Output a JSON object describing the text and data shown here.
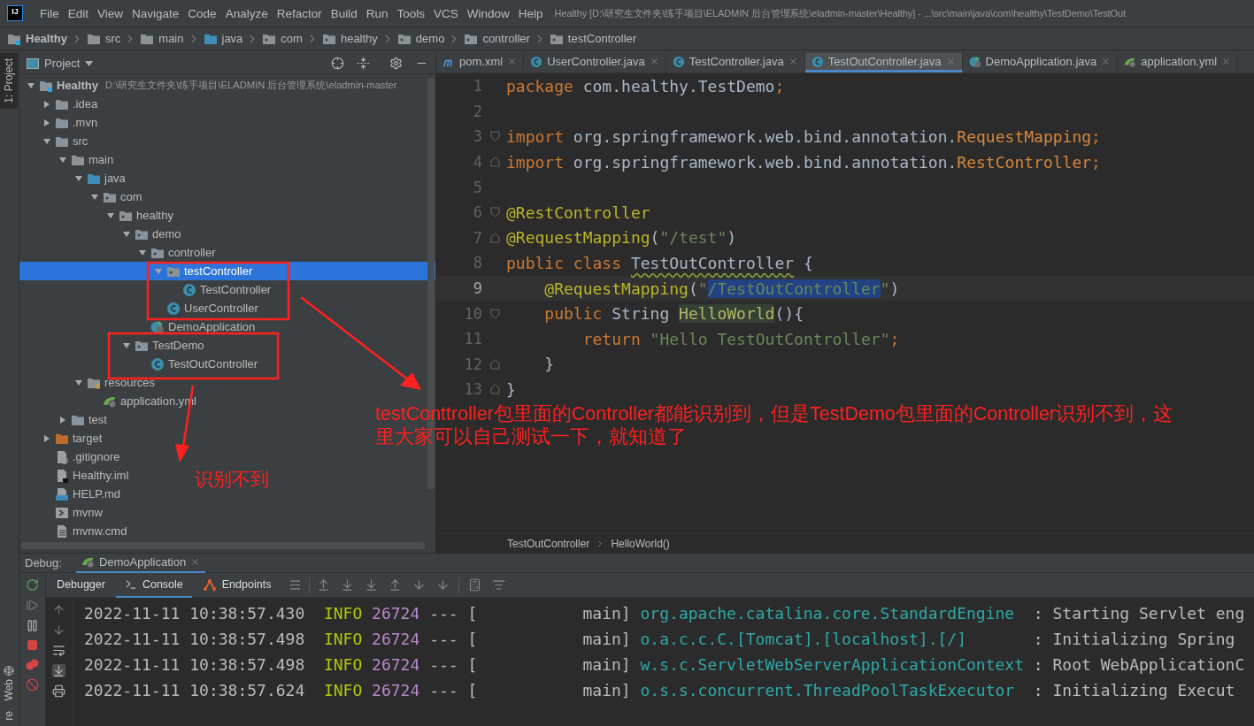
{
  "menu_bar": {
    "logo": "IJ",
    "menus": [
      "File",
      "Edit",
      "View",
      "Navigate",
      "Code",
      "Analyze",
      "Refactor",
      "Build",
      "Run",
      "Tools",
      "VCS",
      "Window",
      "Help"
    ],
    "window_title": "Healthy [D:\\研究生文件夹\\练手项目\\ELADMIN 后台管理系统\\eladmin-master\\Healthy] - ...\\src\\main\\java\\com\\healthy\\TestDemo\\TestOut"
  },
  "breadcrumb": [
    {
      "label": "Healthy",
      "kind": "module"
    },
    {
      "label": "src",
      "kind": "folder"
    },
    {
      "label": "main",
      "kind": "folder"
    },
    {
      "label": "java",
      "kind": "source-folder"
    },
    {
      "label": "com",
      "kind": "package"
    },
    {
      "label": "healthy",
      "kind": "package"
    },
    {
      "label": "demo",
      "kind": "package"
    },
    {
      "label": "controller",
      "kind": "package"
    },
    {
      "label": "testController",
      "kind": "package"
    }
  ],
  "tool_strip": {
    "top": [
      {
        "label": "1: Project",
        "selected": true
      }
    ],
    "bottom": [
      {
        "label": "Web",
        "kind": "web"
      },
      {
        "label": "re",
        "kind": "plain"
      }
    ]
  },
  "project_panel": {
    "title": "Project",
    "tree": [
      {
        "name": "Healthy",
        "kind": "module",
        "path": "D:\\研究生文件夹\\练手项目\\ELADMIN 后台管理系统\\eladmin-master",
        "expanded": true,
        "selected": false,
        "children": [
          {
            "name": ".idea",
            "kind": "folder",
            "expanded": false,
            "selected": false
          },
          {
            "name": ".mvn",
            "kind": "folder",
            "expanded": false,
            "selected": false
          },
          {
            "name": "src",
            "kind": "folder",
            "expanded": true,
            "selected": false,
            "children": [
              {
                "name": "main",
                "kind": "folder",
                "expanded": true,
                "selected": false,
                "children": [
                  {
                    "name": "java",
                    "kind": "source-folder",
                    "expanded": true,
                    "selected": false,
                    "children": [
                      {
                        "name": "com",
                        "kind": "package",
                        "expanded": true,
                        "selected": false,
                        "children": [
                          {
                            "name": "healthy",
                            "kind": "package",
                            "expanded": true,
                            "selected": false,
                            "children": [
                              {
                                "name": "demo",
                                "kind": "package",
                                "expanded": true,
                                "selected": false,
                                "children": [
                                  {
                                    "name": "controller",
                                    "kind": "package",
                                    "expanded": true,
                                    "selected": false,
                                    "children": [
                                      {
                                        "name": "testController",
                                        "kind": "package",
                                        "expanded": true,
                                        "selected": true,
                                        "children": [
                                          {
                                            "name": "TestController",
                                            "kind": "class",
                                            "selected": false
                                          }
                                        ]
                                      },
                                      {
                                        "name": "UserController",
                                        "kind": "class",
                                        "selected": false
                                      }
                                    ]
                                  },
                                  {
                                    "name": "DemoApplication",
                                    "kind": "spring-class",
                                    "selected": false
                                  }
                                ]
                              },
                              {
                                "name": "TestDemo",
                                "kind": "package",
                                "expanded": true,
                                "selected": false,
                                "children": [
                                  {
                                    "name": "TestOutController",
                                    "kind": "class",
                                    "selected": false
                                  }
                                ]
                              }
                            ]
                          }
                        ]
                      }
                    ]
                  },
                  {
                    "name": "resources",
                    "kind": "resources-folder",
                    "expanded": true,
                    "selected": false,
                    "children": [
                      {
                        "name": "application.yml",
                        "kind": "spring-config",
                        "selected": false
                      }
                    ]
                  }
                ]
              },
              {
                "name": "test",
                "kind": "folder",
                "expanded": false,
                "selected": false
              }
            ]
          },
          {
            "name": "target",
            "kind": "excluded-folder",
            "expanded": false,
            "selected": false
          },
          {
            "name": ".gitignore",
            "kind": "ignore-file",
            "selected": false
          },
          {
            "name": "Healthy.iml",
            "kind": "module-file",
            "selected": false
          },
          {
            "name": "HELP.md",
            "kind": "markdown",
            "selected": false
          },
          {
            "name": "mvnw",
            "kind": "script",
            "selected": false
          },
          {
            "name": "mvnw.cmd",
            "kind": "text-file",
            "selected": false
          }
        ]
      }
    ]
  },
  "editor": {
    "tabs": [
      {
        "label": "pom.xml",
        "kind": "maven",
        "selected": false
      },
      {
        "label": "UserController.java",
        "kind": "class",
        "selected": false
      },
      {
        "label": "TestController.java",
        "kind": "class",
        "selected": false
      },
      {
        "label": "TestOutController.java",
        "kind": "class",
        "selected": true
      },
      {
        "label": "DemoApplication.java",
        "kind": "spring-class",
        "selected": false
      },
      {
        "label": "application.yml",
        "kind": "spring-config",
        "selected": false
      }
    ],
    "lines": [
      {
        "number": "1",
        "kind": "plain",
        "current": false,
        "tokens": [
          {
            "text": "package",
            "kind": "keyword"
          },
          {
            "text": " com.healthy.TestDemo",
            "kind": "plain"
          },
          {
            "text": ";",
            "kind": "keyword"
          }
        ]
      },
      {
        "number": "2",
        "kind": "plain",
        "current": false
      },
      {
        "number": "3",
        "kind": "fold-start",
        "current": false,
        "tokens": [
          {
            "text": "import",
            "kind": "keyword"
          },
          {
            "text": " org.springframework.web.bind.annotation.",
            "kind": "plain"
          },
          {
            "text": "RequestMapping",
            "kind": "unused-import"
          },
          {
            "text": ";",
            "kind": "keyword"
          }
        ]
      },
      {
        "number": "4",
        "kind": "fold-end",
        "current": false,
        "tokens": [
          {
            "text": "import",
            "kind": "keyword"
          },
          {
            "text": " org.springframework.web.bind.annotation.",
            "kind": "plain"
          },
          {
            "text": "RestController",
            "kind": "unused-import"
          },
          {
            "text": ";",
            "kind": "keyword"
          }
        ]
      },
      {
        "number": "5",
        "kind": "plain",
        "current": false
      },
      {
        "number": "6",
        "kind": "fold-start",
        "current": false,
        "tokens": [
          {
            "text": "@RestController",
            "kind": "annotation"
          }
        ]
      },
      {
        "number": "7",
        "kind": "fold-end",
        "current": false,
        "tokens": [
          {
            "text": "@RequestMapping",
            "kind": "annotation"
          },
          {
            "text": "(",
            "kind": "plain"
          },
          {
            "text": "\"/test\"",
            "kind": "string"
          },
          {
            "text": ")",
            "kind": "plain"
          }
        ]
      },
      {
        "number": "8",
        "kind": "plain",
        "current": false,
        "tokens": [
          {
            "text": "public class ",
            "kind": "keyword"
          },
          {
            "text": "TestOutController",
            "kind": "typo"
          },
          {
            "text": " {",
            "kind": "plain"
          }
        ]
      },
      {
        "number": "9",
        "kind": "plain",
        "current": true,
        "tokens": [
          {
            "text": "    @RequestMapping",
            "kind": "annotation"
          },
          {
            "text": "(",
            "kind": "plain"
          },
          {
            "text": "\"",
            "kind": "string"
          },
          {
            "text": "/TestOutController",
            "kind": "selected-string"
          },
          {
            "text": "\"",
            "kind": "string"
          },
          {
            "text": ")",
            "kind": "plain"
          }
        ]
      },
      {
        "number": "10",
        "kind": "fold-start",
        "current": false,
        "tokens": [
          {
            "text": "    public ",
            "kind": "keyword"
          },
          {
            "text": "String ",
            "kind": "plain"
          },
          {
            "text": "HelloWorld",
            "kind": "unused-method"
          },
          {
            "text": "(){",
            "kind": "plain"
          }
        ]
      },
      {
        "number": "11",
        "kind": "plain",
        "current": false,
        "tokens": [
          {
            "text": "        return ",
            "kind": "keyword"
          },
          {
            "text": "\"Hello TestOutController\"",
            "kind": "string"
          },
          {
            "text": ";",
            "kind": "keyword"
          }
        ]
      },
      {
        "number": "12",
        "kind": "fold-end",
        "current": false,
        "tokens": [
          {
            "text": "    }",
            "kind": "plain"
          }
        ]
      },
      {
        "number": "13",
        "kind": "fold-end",
        "current": false,
        "tokens": [
          {
            "text": "}",
            "kind": "plain"
          }
        ]
      }
    ],
    "breadcrumb": [
      "TestOutController",
      "HelloWorld()"
    ]
  },
  "debug": {
    "label": "Debug:",
    "session": "DemoApplication",
    "tabs": [
      {
        "label": "Debugger",
        "kind": "plain",
        "selected": false
      },
      {
        "label": "Console",
        "kind": "console",
        "selected": true
      },
      {
        "label": "Endpoints",
        "kind": "endpoints",
        "selected": false
      }
    ],
    "console_rows": [
      {
        "timestamp": "2022-11-11 10:38:57.430",
        "level": "INFO",
        "pid": "26724",
        "separator": "---",
        "thread": "[           main]",
        "logger": "org.apache.catalina.core.StandardEngine",
        "message": ": Starting Servlet eng"
      },
      {
        "timestamp": "2022-11-11 10:38:57.498",
        "level": "INFO",
        "pid": "26724",
        "separator": "---",
        "thread": "[           main]",
        "logger": "o.a.c.c.C.[Tomcat].[localhost].[/]",
        "message": ": Initializing Spring"
      },
      {
        "timestamp": "2022-11-11 10:38:57.498",
        "level": "INFO",
        "pid": "26724",
        "separator": "---",
        "thread": "[           main]",
        "logger": "w.s.c.ServletWebServerApplicationContext",
        "message": ": Root WebApplicationC"
      },
      {
        "timestamp": "2022-11-11 10:38:57.624",
        "level": "INFO",
        "pid": "26724",
        "separator": "---",
        "thread": "[           main]",
        "logger": "o.s.s.concurrent.ThreadPoolTaskExecutor",
        "message": ": Initializing Execut"
      }
    ]
  },
  "annotations": {
    "note": "testConttroller包里面的Controller都能识别到，但是TestDemo包里面的Controller识别不到，这里大家可以自己测试一下，就知道了",
    "callout": "识别不到"
  }
}
